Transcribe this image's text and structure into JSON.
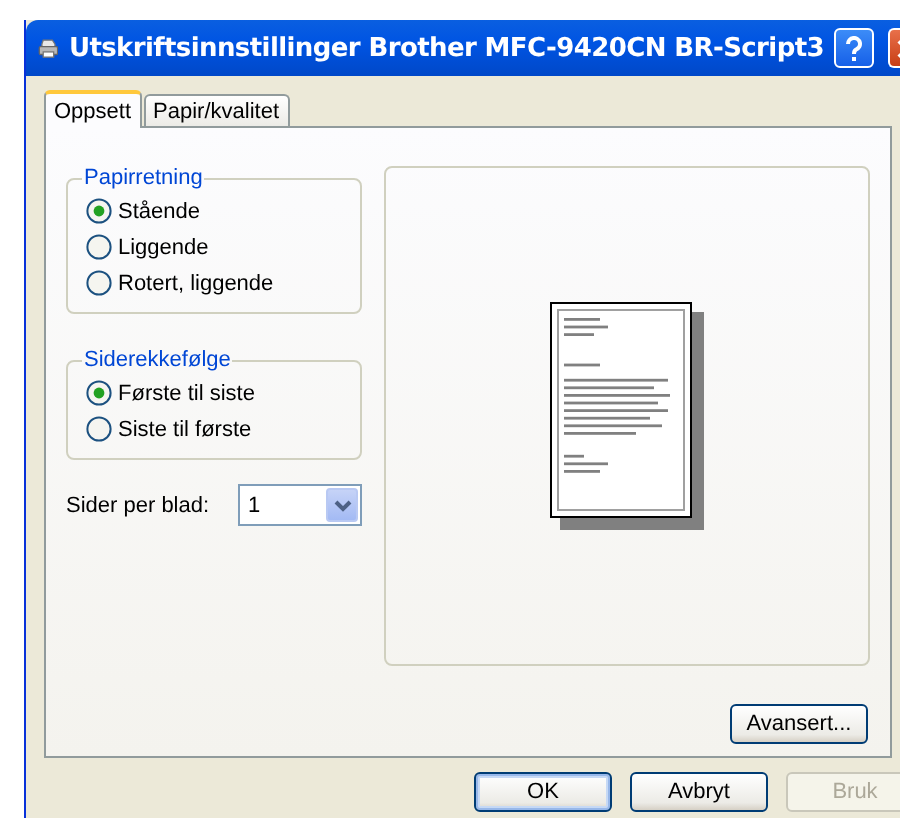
{
  "window": {
    "title": "Utskriftsinnstillinger Brother MFC-9420CN BR-Script3"
  },
  "tabs": [
    {
      "label": "Oppsett",
      "selected": true
    },
    {
      "label": "Papir/kvalitet",
      "selected": false
    }
  ],
  "orientation": {
    "title": "Papirretning",
    "options": [
      {
        "label": "Stående",
        "selected": true
      },
      {
        "label": "Liggende",
        "selected": false
      },
      {
        "label": "Rotert, liggende",
        "selected": false
      }
    ]
  },
  "page_order": {
    "title": "Siderekkefølge",
    "options": [
      {
        "label": "Første til siste",
        "selected": true
      },
      {
        "label": "Siste til første",
        "selected": false
      }
    ]
  },
  "pages_per_sheet": {
    "label": "Sider per blad:",
    "value": "1"
  },
  "advanced_button": "Avansert...",
  "buttons": [
    {
      "label": "OK",
      "default": true,
      "disabled": false
    },
    {
      "label": "Avbryt",
      "default": false,
      "disabled": false
    },
    {
      "label": "Bruk",
      "default": false,
      "disabled": true
    }
  ]
}
